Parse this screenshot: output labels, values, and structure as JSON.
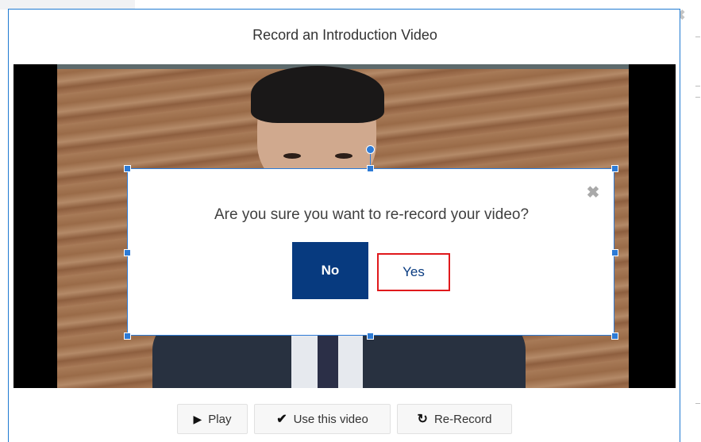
{
  "modal": {
    "title": "Record an Introduction Video",
    "close_icon": "close-icon"
  },
  "confirm_dialog": {
    "message": "Are you sure you want to re-record your video?",
    "no_label": "No",
    "yes_label": "Yes",
    "close_icon": "close-icon"
  },
  "controls": [
    {
      "label": "Play",
      "icon": "play-icon"
    },
    {
      "label": "Use this video",
      "icon": "check-icon"
    },
    {
      "label": "Re-Record",
      "icon": "refresh-icon"
    }
  ],
  "colors": {
    "accent_blue": "#1f7ad2",
    "no_button_bg": "#073a7f",
    "yes_highlight_border": "#e0191c"
  }
}
